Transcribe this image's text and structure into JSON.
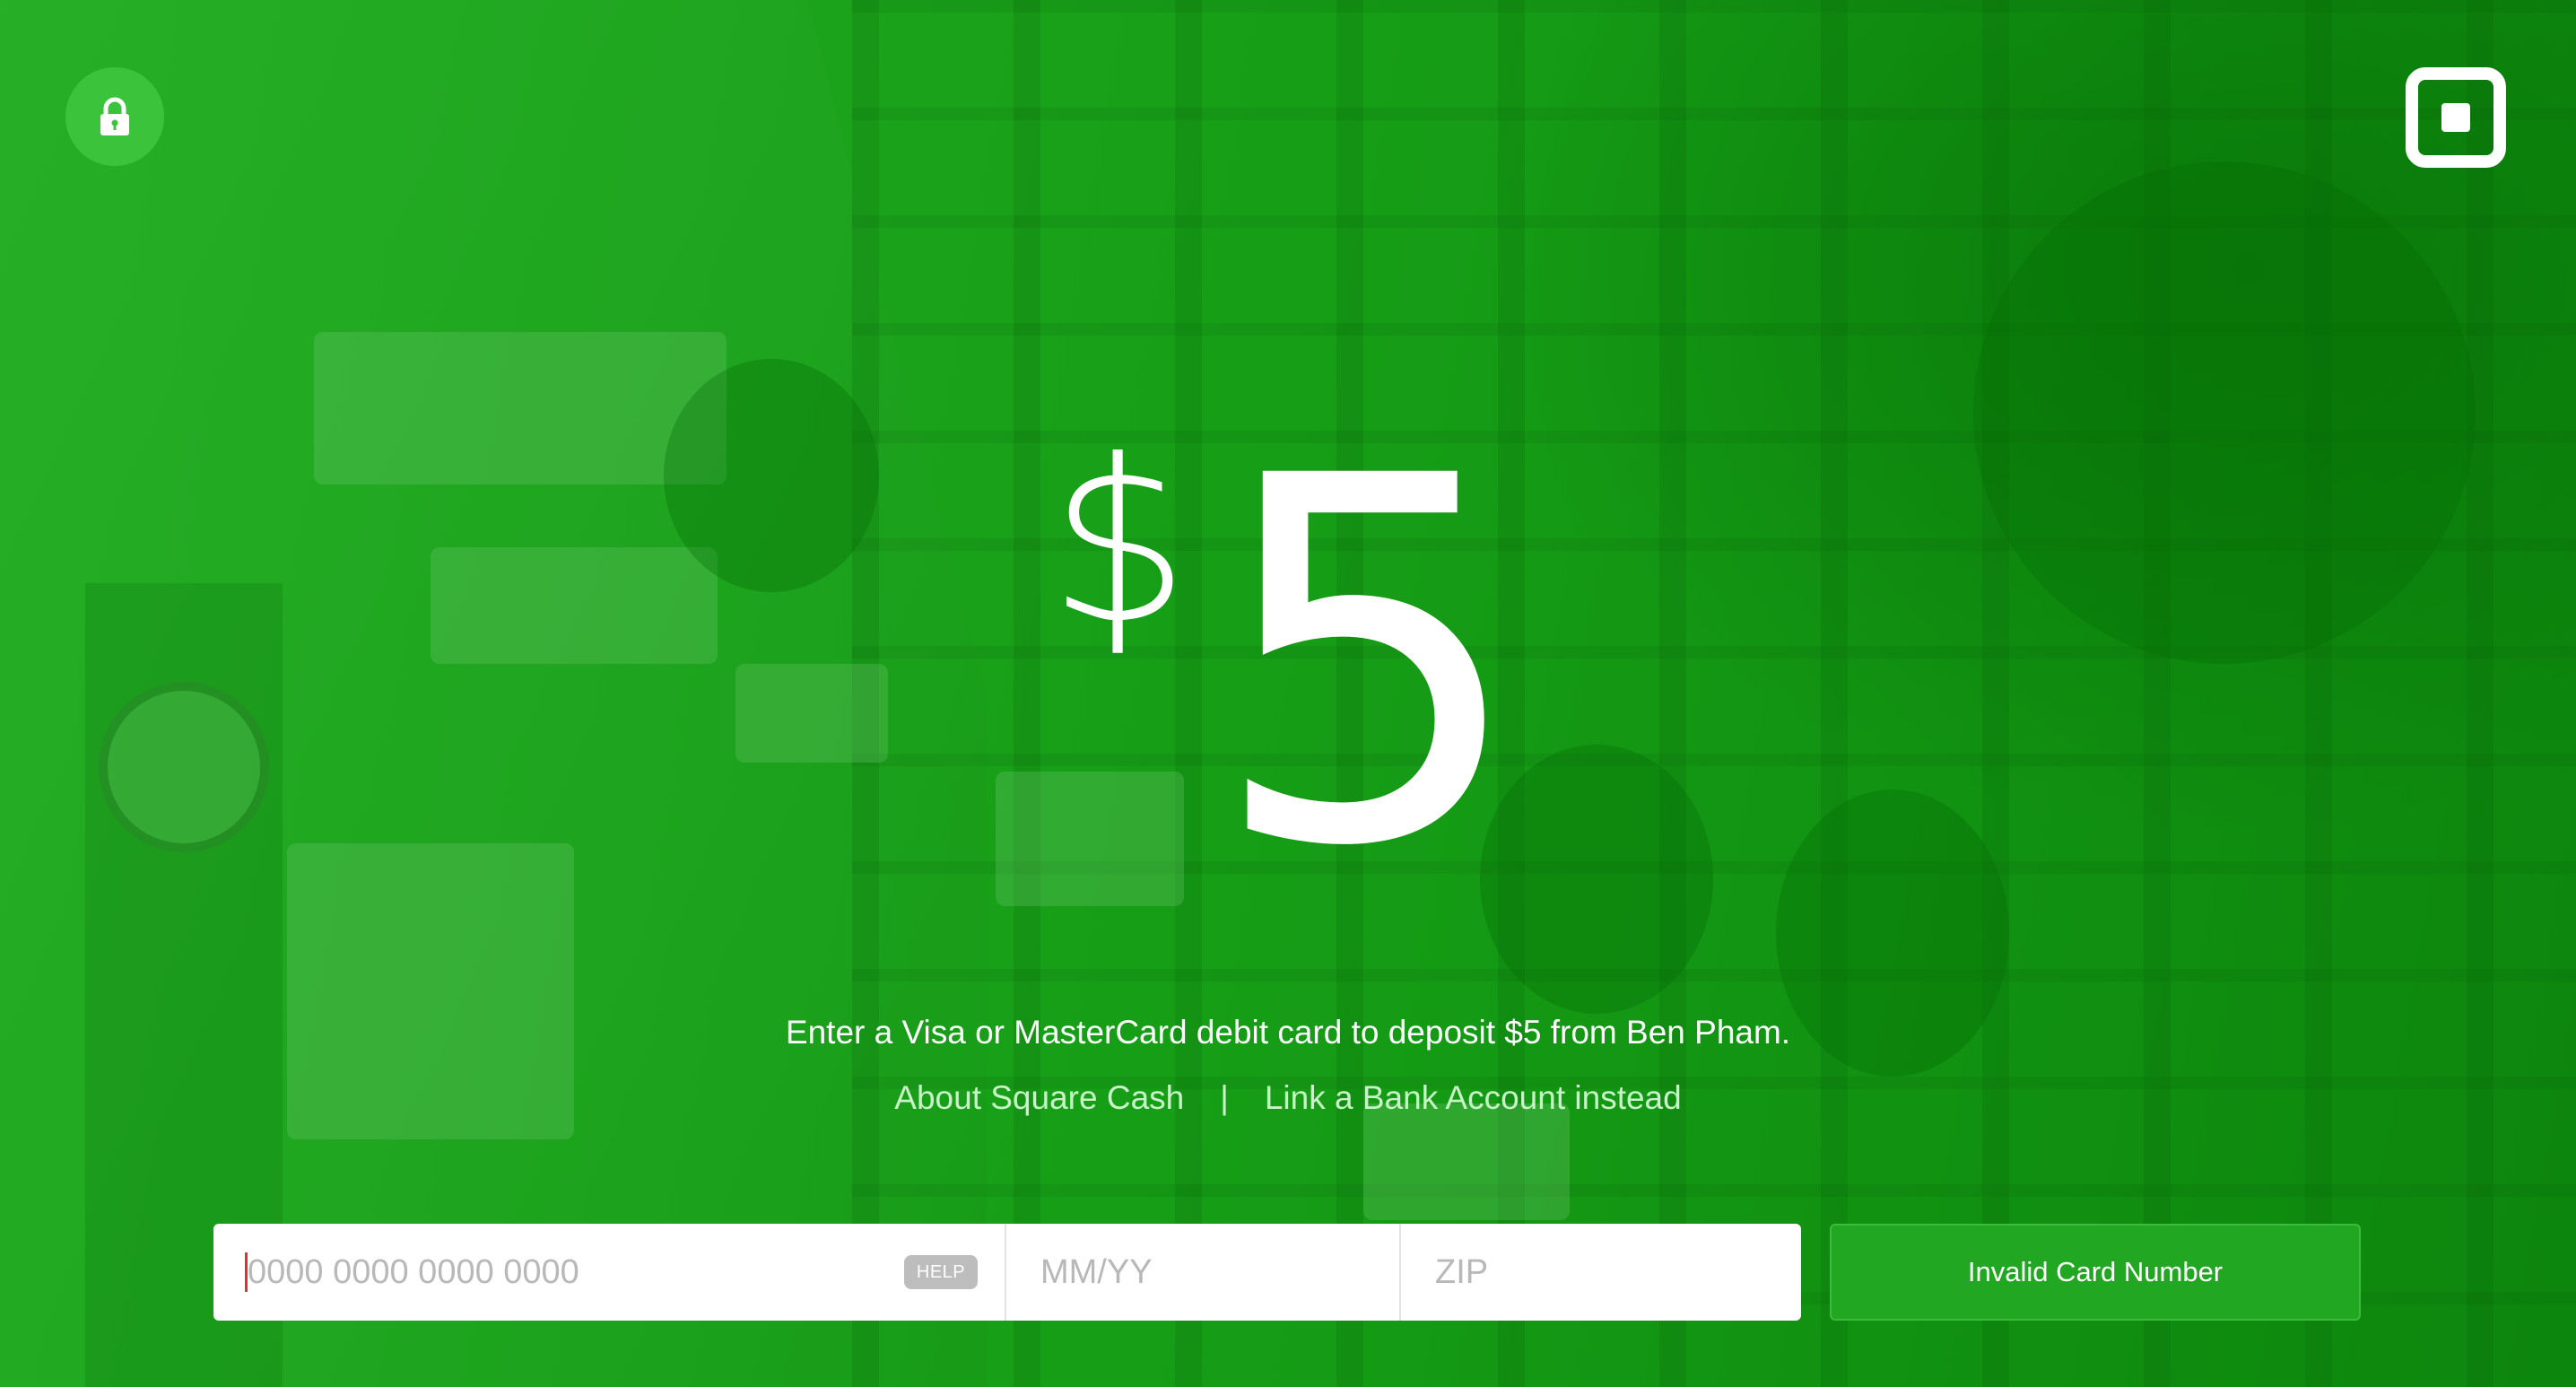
{
  "icons": {
    "lock": "lock-icon",
    "logo": "square-logo-icon"
  },
  "colors": {
    "background_green": "#1aa31a",
    "lock_badge": "#3bc43b",
    "submit_button": "#22a722",
    "caret": "#e03030",
    "help_badge": "#bdbdbd"
  },
  "payment": {
    "currency_symbol": "$",
    "amount": "5",
    "instructions": "Enter a Visa or MasterCard debit card to deposit $5 from Ben Pham."
  },
  "links": {
    "about": "About Square Cash",
    "separator": "|",
    "bank": "Link a Bank Account instead"
  },
  "card_form": {
    "card_number": {
      "value": "",
      "placeholder": "0000 0000 0000 0000"
    },
    "help_label": "HELP",
    "expiry": {
      "value": "",
      "placeholder": "MM/YY"
    },
    "zip": {
      "value": "",
      "placeholder": "ZIP"
    },
    "submit_label": "Invalid Card Number"
  }
}
